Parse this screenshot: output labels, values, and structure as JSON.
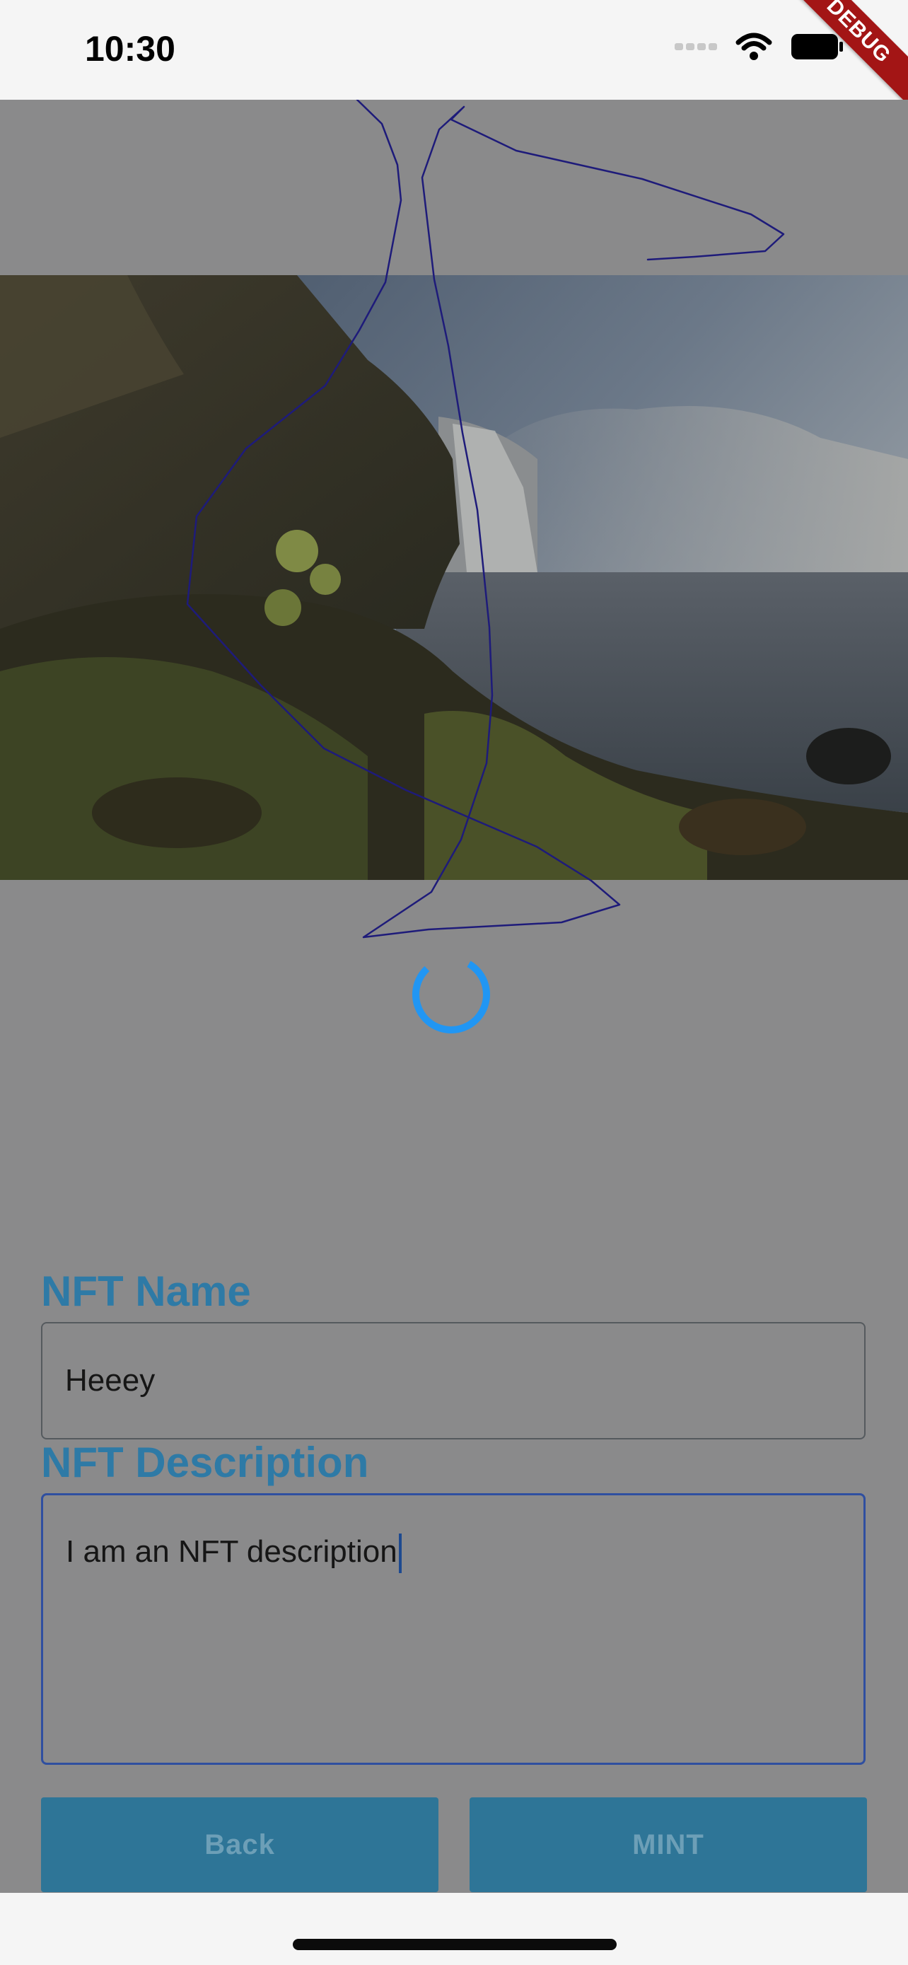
{
  "status_bar": {
    "time": "10:30",
    "debug_label": "DEBUG",
    "icons": [
      "signal-dots-icon",
      "wifi-icon",
      "battery-icon"
    ]
  },
  "canvas": {
    "stroke_color": "#1e1b7a",
    "image": "waterfall-landscape-photo",
    "loading": true
  },
  "form": {
    "name_label": "NFT Name",
    "name_value": "Heeey",
    "description_label": "NFT Description",
    "description_value": "I am an NFT description"
  },
  "buttons": {
    "back_label": "Back",
    "mint_label": "MINT"
  },
  "colors": {
    "accent": "#2e7aa6",
    "button": "#2e7597",
    "overlay": "#8a8a8b",
    "spinner": "#2196f3"
  }
}
